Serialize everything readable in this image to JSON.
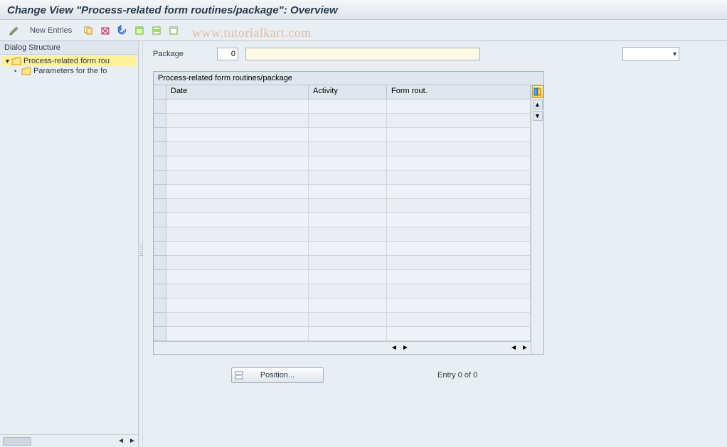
{
  "title": "Change View \"Process-related form routines/package\": Overview",
  "watermark": "www.tutorialkart.com",
  "toolbar": {
    "new_entries": "New Entries"
  },
  "sidebar": {
    "header": "Dialog Structure",
    "items": [
      {
        "label": "Process-related form rou",
        "selected": true,
        "open": true
      },
      {
        "label": "Parameters for the fo",
        "selected": false,
        "open": false
      }
    ]
  },
  "content": {
    "package_label": "Package",
    "package_num": "0",
    "package_name": "",
    "dropdown_value": "",
    "grid_title": "Process-related form routines/package",
    "columns": {
      "date": "Date",
      "activity": "Activity",
      "form": "Form rout."
    },
    "row_count": 17
  },
  "footer": {
    "position_label": "Position...",
    "entry_text": "Entry 0 of 0"
  }
}
